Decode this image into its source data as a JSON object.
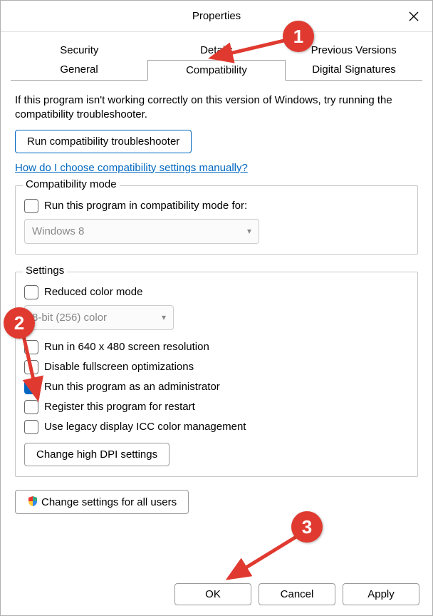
{
  "titlebar": {
    "title": "Properties"
  },
  "tabs": {
    "row1": [
      "Security",
      "Details",
      "Previous Versions"
    ],
    "row2": [
      "General",
      "Compatibility",
      "Digital Signatures"
    ],
    "active": "Compatibility"
  },
  "intro": "If this program isn't working correctly on this version of Windows, try running the compatibility troubleshooter.",
  "troubleshooter_btn": "Run compatibility troubleshooter",
  "help_link": "How do I choose compatibility settings manually?",
  "compat_mode": {
    "legend": "Compatibility mode",
    "checkbox_label": "Run this program in compatibility mode for:",
    "select_value": "Windows 8"
  },
  "settings": {
    "legend": "Settings",
    "reduced_color": "Reduced color mode",
    "color_select": "8-bit (256) color",
    "run_640": "Run in 640 x 480 screen resolution",
    "disable_fullscreen": "Disable fullscreen optimizations",
    "run_admin": "Run this program as an administrator",
    "register_restart": "Register this program for restart",
    "legacy_icc": "Use legacy display ICC color management",
    "dpi_btn": "Change high DPI settings"
  },
  "all_users_btn": "Change settings for all users",
  "buttons": {
    "ok": "OK",
    "cancel": "Cancel",
    "apply": "Apply"
  },
  "annotations": {
    "b1": "1",
    "b2": "2",
    "b3": "3"
  }
}
